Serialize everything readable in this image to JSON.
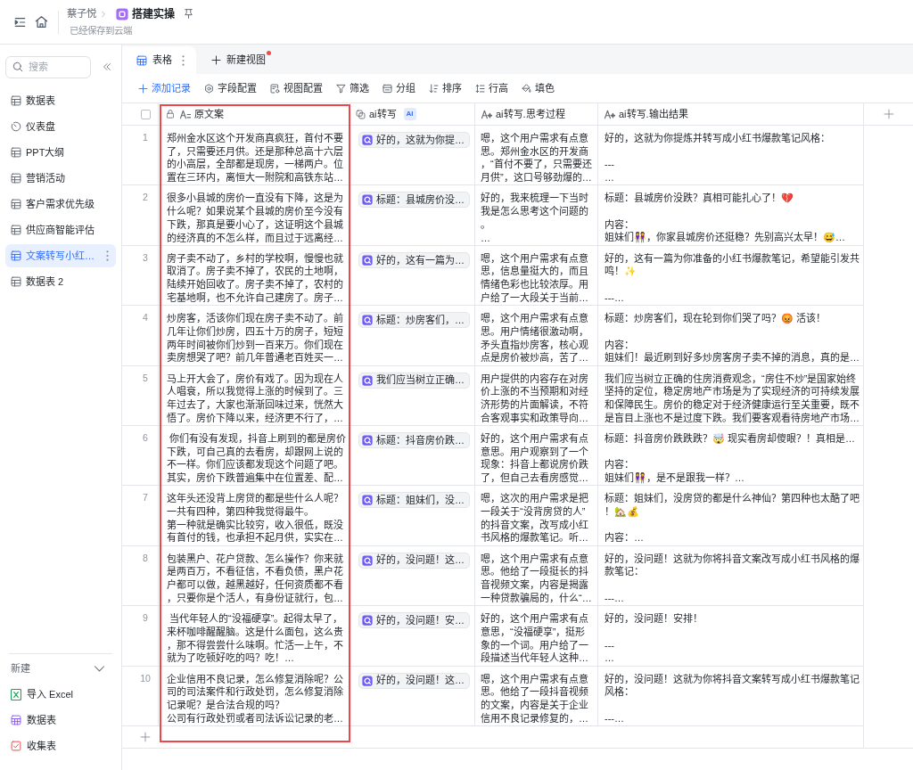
{
  "header": {
    "breadcrumb": [
      {
        "label": "蔡子悦",
        "kind": "user"
      },
      {
        "label": "搭建实操",
        "kind": "doc"
      }
    ],
    "status": "已经保存到云端"
  },
  "sidebar": {
    "search": {
      "placeholder": "搜索"
    },
    "items": [
      {
        "label": "数据表",
        "kind": "table",
        "selected": false
      },
      {
        "label": "仪表盘",
        "kind": "dashboard",
        "selected": false
      },
      {
        "label": "PPT大纲",
        "kind": "table",
        "selected": false
      },
      {
        "label": "营销活动",
        "kind": "table",
        "selected": false
      },
      {
        "label": "客户需求优先级",
        "kind": "table",
        "selected": false
      },
      {
        "label": "供应商智能评估",
        "kind": "table",
        "selected": false
      },
      {
        "label": "文案转写小红…",
        "kind": "table",
        "selected": true
      },
      {
        "label": "数据表 2",
        "kind": "table",
        "selected": false
      }
    ],
    "new_menu": {
      "title": "新建",
      "expanded": true,
      "items": [
        {
          "label": "导入 Excel",
          "kind": "excel"
        },
        {
          "label": "数据表",
          "kind": "table"
        },
        {
          "label": "收集表",
          "kind": "form"
        }
      ]
    }
  },
  "view_tabs": [
    {
      "label": "表格",
      "kind": "grid",
      "selected": true,
      "notification": false
    },
    {
      "label": "新建视图",
      "kind": "add",
      "selected": false,
      "notification": true
    }
  ],
  "toolbar": [
    {
      "label": "添加记录",
      "kind": "add"
    },
    {
      "label": "字段配置",
      "kind": "fields"
    },
    {
      "label": "视图配置",
      "kind": "view"
    },
    {
      "label": "筛选",
      "kind": "filter"
    },
    {
      "label": "分组",
      "kind": "group"
    },
    {
      "label": "排序",
      "kind": "sort"
    },
    {
      "label": "行高",
      "kind": "row_height"
    },
    {
      "label": "填色",
      "kind": "fill"
    }
  ],
  "table": {
    "select_all": {
      "checked": false
    },
    "columns": [
      {
        "label": "原文案",
        "kind": "text",
        "locked": true,
        "highlighted": true
      },
      {
        "label": "ai转写",
        "kind": "ai",
        "badge": "AI",
        "locked": false,
        "highlighted": false
      },
      {
        "label": "ai转写.思考过程",
        "kind": "ai_text",
        "locked": false,
        "highlighted": false
      },
      {
        "label": "ai转写.输出结果",
        "kind": "ai_text",
        "locked": false,
        "highlighted": false
      }
    ],
    "rows": [
      {
        "number": "1",
        "cells": [
          [
            [
              "郑州金水区这个开发商真疯狂，首付不要了，只需要还月供。还是那种总高十六层的小高层，全部都是现房，一梯两户。位置在三环内，离恒大一附院和高铁东站…"
            ]
          ],
          "好的，这就为你提…",
          [
            [
              "嗯，这个用户需求有点意思。郑州金水区的开发商，“首付不要了，只需要还月供”，这口号够劲爆的…"
            ]
          ],
          [
            [
              "好的，这就为你提炼并转写成小红书爆款笔记风格："
            ],
            [
              "---",
              "…"
            ]
          ]
        ]
      },
      {
        "number": "2",
        "cells": [
          [
            [
              "很多小县城的房价一直没有下降，这是为什么呢？如果说某个县城的房价至今没有下跌，那真是要小心了，这证明这个县城的经济真的不怎么样，而且过于远离经…"
            ]
          ],
          "标题：县城房价没…",
          [
            [
              "好的，我来梳理一下当时我是怎么思考这个问题的。",
              "…"
            ]
          ],
          [
            [
              "标题：县城房价没跌？真相可能扎心了！💔"
            ],
            [
              "内容：",
              "姐妹们👭，你家县城房价还挺稳？先别高兴太早！😅…"
            ]
          ]
        ]
      },
      {
        "number": "3",
        "cells": [
          [
            [
              "房子卖不动了，乡村的学校啊，慢慢也就取消了。房子卖不掉了，农民的土地啊，陆续开始回收了。房子卖不掉了，农村的宅基地啊，也不允许自己建房了。房子…"
            ]
          ],
          "好的，这有一篇为…",
          [
            [
              "嗯，这个用户需求有点意思，信息量挺大的，而且情绪色彩也比较浓厚。用户给了一大段关于当前…"
            ]
          ],
          [
            [
              "好的，这有一篇为你准备的小红书爆款笔记，希望能引发共鸣！✨"
            ],
            [
              "---…"
            ]
          ]
        ]
      },
      {
        "number": "4",
        "cells": [
          [
            [
              "炒房客，活该你们现在房子卖不动了。前几年让你们炒房，四五十万的房子，短短两年时间被你们炒到一百来万。你们现在卖房想哭了吧？前几年普通老百姓买一…"
            ]
          ],
          "标题：炒房客们，…",
          [
            [
              "嗯，这个用户需求有点意思。用户情绪很激动啊，矛头直指炒房客，核心观点是房价被炒高，苦了…"
            ]
          ],
          [
            [
              "标题：炒房客们，现在轮到你们哭了吗？😡 活该！"
            ],
            [
              "内容：",
              "姐妹们！最近刷到好多炒房客房子卖不掉的消息，真的是…"
            ]
          ]
        ]
      },
      {
        "number": "5",
        "cells": [
          [
            [
              "马上开大会了，房价有戏了。因为现在人人唱衰，所以我觉得上涨的时候到了。三年过去了，大家也渐渐回味过来，恍然大悟了。房价下降以来，经济更不行了，…"
            ]
          ],
          "我们应当树立正确…",
          [
            [
              "用户提供的内容存在对房价上涨的不当预期和对经济形势的片面解读，不符合客观事实和政策导向…"
            ]
          ],
          [
            [
              "我们应当树立正确的住房消费观念，“房住不炒”是国家始终坚持的定位，稳定房地产市场是为了实现经济的可持续发展和保障民生。房价的稳定对于经济健康运行至关重要，既不是盲目上涨也不是过度下跌。我们要客观看待房地产市场…"
            ]
          ]
        ]
      },
      {
        "number": "6",
        "cells": [
          [
            [
              " 你们有没有发现，抖音上刷到的都是房价下跌，可自己真的去看房，却跟网上说的不一样。你们应该都发现这个问题了吧。其实，房价下跌普遍集中在位置差、配…"
            ]
          ],
          "标题：抖音房价跌…",
          [
            [
              "好的，这个用户需求有点意思。用户观察到了一个现象：抖音上都说房价跌了，但自己去看房感觉…"
            ]
          ],
          [
            [
              "标题：抖音房价跌跌跌？🤯 现实看房却傻眼？！真相是…"
            ],
            [
              "内容：",
              "姐妹们👭，是不是跟我一样？…"
            ]
          ]
        ]
      },
      {
        "number": "7",
        "cells": [
          [
            [
              "这年头还没背上房贷的都是些什么人呢？",
              "一共有四种，第四种我觉得最牛。",
              "第一种就是确实比较穷，收入很低，既没有首付的钱，也承担不起月供，实实在…"
            ]
          ],
          "标题：姐妹们，没…",
          [
            [
              "嗯，这次的用户需求是把一段关于“没背房贷的人”的抖音文案，改写成小红书风格的爆款笔记。听…"
            ]
          ],
          [
            [
              "标题：姐妹们，没房贷的都是什么神仙？第四种也太酷了吧！🏡💰"
            ],
            [
              "内容：…"
            ]
          ]
        ]
      },
      {
        "number": "8",
        "cells": [
          [
            [
              "包装黑户、花户贷款、怎么操作？你来就是两百万，不看征信，不看负债，黑户花户都可以做，越黑越好，任何资质都不看，只要你是个活人，有身份证就行，包…"
            ]
          ],
          "好的，没问题！这…",
          [
            [
              "嗯，这个用户需求有点意思。他给了一段挺长的抖音视频文案，内容是揭露一种贷款骗局的，什么“…"
            ]
          ],
          [
            [
              "好的，没问题！这就为你将抖音文案改写成小红书风格的爆款笔记："
            ],
            [
              "---…"
            ]
          ]
        ]
      },
      {
        "number": "9",
        "cells": [
          [
            [
              " 当代年轻人的“没福硬享”。起得太早了，来杯咖啡醒醒脑。这是什么面包，这么贵，那不得尝尝什么味啊。忙活一上午，不就为了吃顿好吃的吗？吃！…"
            ]
          ],
          "好的，没问题！安…",
          [
            [
              "好的，这个用户需求有点意思，“没福硬享”，挺形象的一个词。用户给了一段描述当代年轻人这种…"
            ]
          ],
          [
            [
              "好的，没问题！安排！"
            ],
            [
              "---",
              "…"
            ]
          ]
        ]
      },
      {
        "number": "10",
        "cells": [
          [
            [
              "企业信用不良记录，怎么修复消除呢？公司的司法案件和行政处罚，怎么修复消除记录呢？是合法合规的吗？",
              "公司有行政处罚或者司法诉讼记录的老…"
            ]
          ],
          "好的，没问题！这…",
          [
            [
              "嗯，这个用户需求有点意思。他给了一段抖音视频的文案，内容是关于企业信用不良记录修复的，…"
            ]
          ],
          [
            [
              "好的，没问题！这就为你将抖音文案转写成小红书爆款笔记风格："
            ],
            [
              "---…"
            ]
          ]
        ]
      }
    ]
  }
}
